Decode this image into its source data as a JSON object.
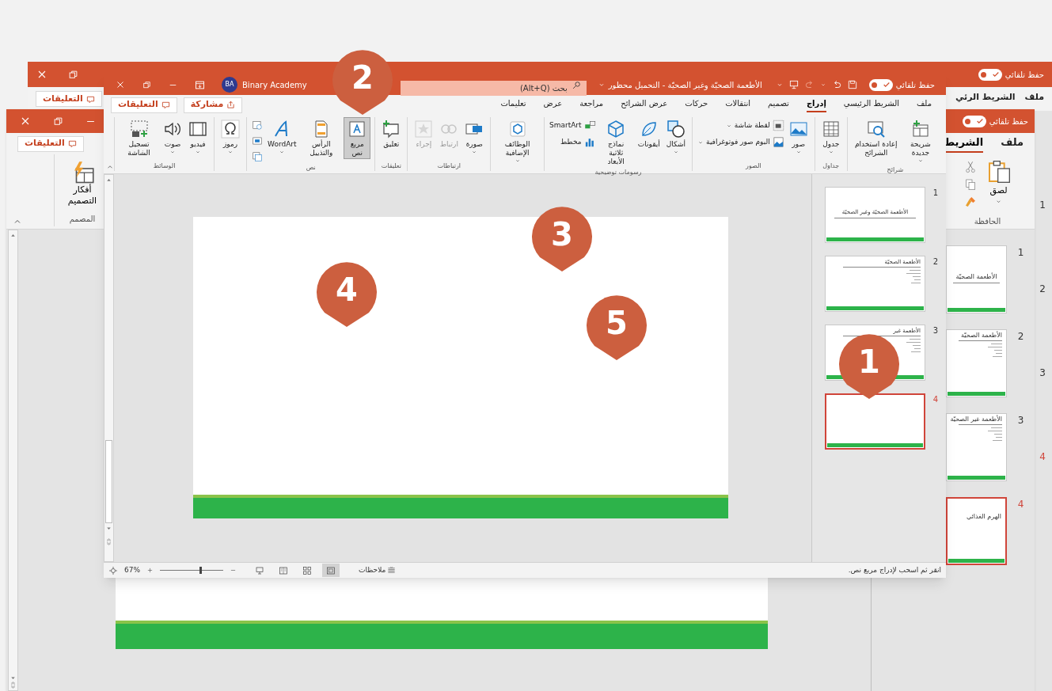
{
  "back_window": {
    "autosave": {
      "label": "حفظ تلقائي",
      "on": true
    },
    "comments_button": "التعليقات",
    "tabs": [
      {
        "label": "ملف",
        "selected": false
      },
      {
        "label": "الشريط الرئي",
        "selected": false
      }
    ],
    "slide_numbers": [
      {
        "number": "1",
        "selected": false
      },
      {
        "number": "2",
        "selected": false
      },
      {
        "number": "3",
        "selected": false
      },
      {
        "number": "4",
        "selected": true
      }
    ]
  },
  "middle_window": {
    "autosave": {
      "label": "حفظ تلقائي",
      "on": true
    },
    "comments_button": "التعليقات",
    "tabs": [
      {
        "label": "ملف",
        "selected": false
      },
      {
        "label": "الشريط",
        "selected": true
      }
    ],
    "designer": {
      "button": "أفكار التصميم",
      "group": "المصمم"
    },
    "clipboard": {
      "button": "لصق",
      "group": "الحافظة"
    },
    "thumbnails": [
      {
        "number": "1",
        "kind": "title",
        "title": "الأطعمة الصحيّة",
        "selected": false
      },
      {
        "number": "2",
        "kind": "content",
        "title": "الأطعمة الصحيّة",
        "selected": false
      },
      {
        "number": "3",
        "kind": "content",
        "title": "الأطعمة غير الصحيّة",
        "selected": false
      },
      {
        "number": "4",
        "kind": "heading",
        "title": "الهرم الغذائي",
        "selected": true
      }
    ]
  },
  "front_window": {
    "account": {
      "initials": "BA",
      "name": "Binary Academy"
    },
    "search": {
      "placeholder": "بحث (Alt+Q)"
    },
    "document_title": "الأطعمة الصحيّة وغير الصحيّة - التحميل محظور",
    "autosave": {
      "label": "حفظ تلقائي",
      "on": true
    },
    "share_button": "مشاركة",
    "comments_button": "التعليقات",
    "tabs": [
      {
        "label": "ملف",
        "selected": false
      },
      {
        "label": "الشريط الرئيسي",
        "selected": false
      },
      {
        "label": "إدراج",
        "selected": true
      },
      {
        "label": "تصميم",
        "selected": false
      },
      {
        "label": "انتقالات",
        "selected": false
      },
      {
        "label": "حركات",
        "selected": false
      },
      {
        "label": "عرض الشرائح",
        "selected": false
      },
      {
        "label": "مراجعة",
        "selected": false
      },
      {
        "label": "عرض",
        "selected": false
      },
      {
        "label": "تعليمات",
        "selected": false
      }
    ],
    "ribbon_groups": [
      {
        "label": "شرائح",
        "buttons": [
          {
            "kind": "large",
            "label": "شريحة جديدة",
            "dropdown": true,
            "disabled": false,
            "selected": false
          },
          {
            "kind": "large",
            "label": "إعادة استخدام الشرائح",
            "dropdown": false,
            "disabled": false,
            "selected": false
          }
        ]
      },
      {
        "label": "جداول",
        "buttons": [
          {
            "kind": "large",
            "label": "جدول",
            "dropdown": true,
            "disabled": false,
            "selected": false
          }
        ]
      },
      {
        "label": "الصور",
        "buttons": [
          {
            "kind": "large",
            "label": "صور",
            "dropdown": true,
            "disabled": false,
            "selected": false
          },
          {
            "kind": "small",
            "label": "لقطة شاشة",
            "dropdown": true,
            "disabled": false,
            "selected": false
          },
          {
            "kind": "small",
            "label": "البوم صور فوتوغرافية",
            "dropdown": true,
            "disabled": false,
            "selected": false
          }
        ]
      },
      {
        "label": "رسومات توضيحية",
        "buttons": [
          {
            "kind": "large",
            "label": "أشكال",
            "dropdown": true,
            "disabled": false,
            "selected": false
          },
          {
            "kind": "large",
            "label": "أيقونات",
            "dropdown": false,
            "disabled": false,
            "selected": false
          },
          {
            "kind": "large",
            "label": "نماذج ثلاثية الأبعاد",
            "dropdown": false,
            "disabled": false,
            "selected": false
          },
          {
            "kind": "small",
            "label": "SmartArt",
            "dropdown": false,
            "disabled": false,
            "selected": false
          },
          {
            "kind": "small",
            "label": "مخطط",
            "dropdown": false,
            "disabled": false,
            "selected": false
          }
        ]
      },
      {
        "buttons": [
          {
            "kind": "large",
            "label": "الوظائف الإضافية",
            "dropdown": true,
            "disabled": false,
            "selected": false
          }
        ]
      },
      {
        "label": "ارتباطات",
        "buttons": [
          {
            "kind": "large",
            "label": "صورة",
            "dropdown": true,
            "disabled": false,
            "selected": false
          },
          {
            "kind": "large",
            "label": "ارتباط",
            "dropdown": false,
            "disabled": true,
            "selected": false
          },
          {
            "kind": "large",
            "label": "إجراء",
            "dropdown": false,
            "disabled": true,
            "selected": false
          }
        ]
      },
      {
        "label": "تعليقات",
        "buttons": [
          {
            "kind": "large",
            "label": "تعليق",
            "dropdown": false,
            "disabled": false,
            "selected": false
          }
        ]
      },
      {
        "label": "نص",
        "buttons": [
          {
            "kind": "large",
            "label": "مربع نص",
            "dropdown": false,
            "disabled": false,
            "selected": true
          },
          {
            "kind": "large",
            "label": "الرأس والتذييل",
            "dropdown": false,
            "disabled": false,
            "selected": false
          },
          {
            "kind": "large",
            "label": "WordArt",
            "dropdown": true,
            "disabled": false,
            "selected": false
          },
          {
            "kind": "icon",
            "dropdown": false,
            "disabled": false,
            "selected": false
          },
          {
            "kind": "icon",
            "dropdown": false,
            "disabled": false,
            "selected": false
          },
          {
            "kind": "icon",
            "dropdown": false,
            "disabled": false,
            "selected": false
          }
        ]
      },
      {
        "buttons": [
          {
            "kind": "large",
            "label": "رموز",
            "dropdown": true,
            "disabled": false,
            "selected": false
          }
        ]
      },
      {
        "label": "الوسائط",
        "buttons": [
          {
            "kind": "large",
            "label": "فيديو",
            "dropdown": true,
            "disabled": false,
            "selected": false
          },
          {
            "kind": "large",
            "label": "صوت",
            "dropdown": true,
            "disabled": false,
            "selected": false
          },
          {
            "kind": "large",
            "label": "تسجيل الشاشة",
            "dropdown": false,
            "disabled": false,
            "selected": false
          }
        ]
      }
    ],
    "thumbnails": [
      {
        "number": "1",
        "kind": "title",
        "title": "الأطعمة الصحيّة وغير الصحيّة",
        "selected": false
      },
      {
        "number": "2",
        "kind": "content",
        "title": "الأطعمة الصحيّة",
        "selected": false
      },
      {
        "number": "3",
        "kind": "content",
        "title": "الأطعمة غير",
        "selected": false
      },
      {
        "number": "4",
        "kind": "blank",
        "selected": true
      }
    ],
    "status_bar": {
      "hint": "انقر ثم اسحب لإدراج مربع نص.",
      "notes": "ملاحظات",
      "zoom": "67%",
      "zoom_slider": {
        "level": 0.62
      },
      "views": [
        {
          "selected": false
        },
        {
          "selected": false
        },
        {
          "selected": false
        },
        {
          "selected": true
        }
      ]
    }
  },
  "callouts": [
    {
      "number": "2"
    },
    {
      "number": "3"
    },
    {
      "number": "4"
    },
    {
      "number": "5"
    },
    {
      "number": "1"
    }
  ]
}
